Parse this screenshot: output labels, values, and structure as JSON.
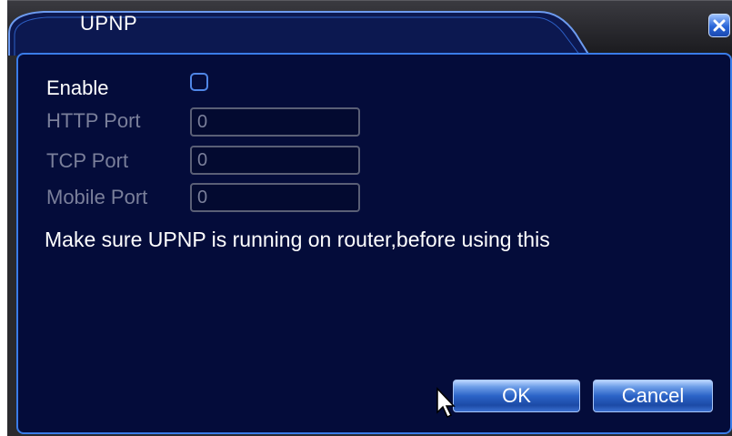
{
  "window": {
    "title": "UPNP",
    "close_icon": "close-icon"
  },
  "form": {
    "enable_label": "Enable",
    "enable_checked": false,
    "http_port_label": "HTTP Port",
    "http_port_value": "0",
    "tcp_port_label": "TCP Port",
    "tcp_port_value": "0",
    "mobile_port_label": "Mobile Port",
    "mobile_port_value": "0",
    "message": "Make sure UPNP is running on router,before using this"
  },
  "buttons": {
    "ok_label": "OK",
    "cancel_label": "Cancel"
  },
  "colors": {
    "panel_background": "#040c3a",
    "panel_border": "#3a7ce8",
    "button_blue": "#2b63c7",
    "disabled_text": "#7a7f9a",
    "active_text": "#ffffff"
  }
}
